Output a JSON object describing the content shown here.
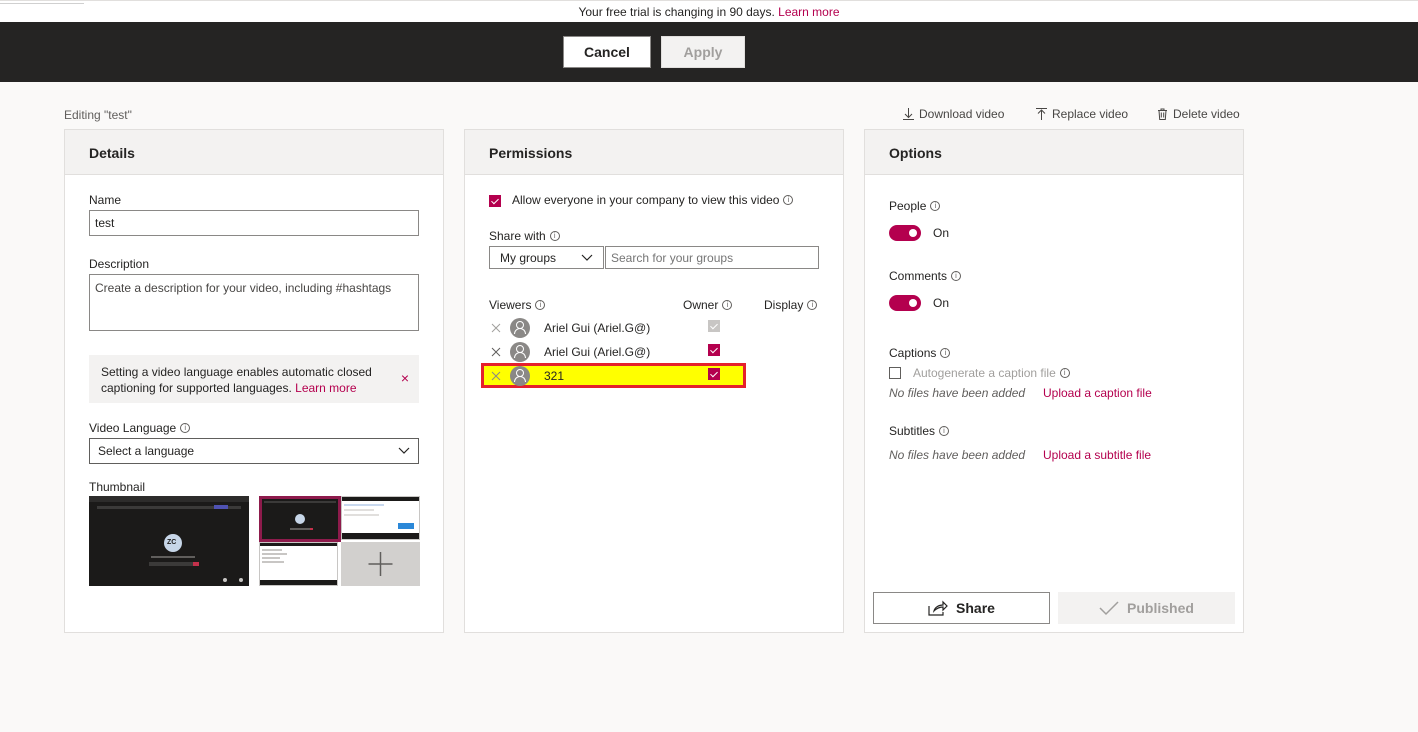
{
  "trial_banner": {
    "text": "Your free trial is changing in 90 days.",
    "link": "Learn more"
  },
  "actions": {
    "cancel": "Cancel",
    "apply": "Apply"
  },
  "editing_label": "Editing \"test\"",
  "video_actions": {
    "download": "Download video",
    "replace": "Replace video",
    "delete": "Delete video"
  },
  "details": {
    "title": "Details",
    "name_label": "Name",
    "name_value": "test",
    "description_label": "Description",
    "description_placeholder": "Create a description for your video, including #hashtags",
    "banner_text": "Setting a video language enables automatic closed captioning for supported languages.",
    "banner_link": "Learn more",
    "language_label": "Video Language",
    "language_value": "Select a language",
    "thumbnail_label": "Thumbnail",
    "thumb_initials": "ZC"
  },
  "permissions": {
    "title": "Permissions",
    "allow_everyone": "Allow everyone in your company to view this video",
    "share_with_label": "Share with",
    "share_with_value": "My groups",
    "search_placeholder": "Search for your groups",
    "col_viewers": "Viewers",
    "col_owner": "Owner",
    "col_display": "Display",
    "viewers": [
      {
        "name": "Ariel Gui (Ariel.G@)",
        "owner": "disabled"
      },
      {
        "name": "Ariel Gui (Ariel.G@)",
        "owner": "checked"
      },
      {
        "name": "321",
        "owner": "checked",
        "highlighted": true
      }
    ]
  },
  "options": {
    "title": "Options",
    "people_label": "People",
    "people_state": "On",
    "comments_label": "Comments",
    "comments_state": "On",
    "captions_label": "Captions",
    "autogenerate": "Autogenerate a caption file",
    "no_files_captions": "No files have been added",
    "upload_caption": "Upload a caption file",
    "subtitles_label": "Subtitles",
    "no_files_subtitles": "No files have been added",
    "upload_subtitle": "Upload a subtitle file",
    "share": "Share",
    "published": "Published"
  },
  "colors": {
    "accent": "#b4004e",
    "highlight": "#ffff00",
    "highlight_border": "#e5202c",
    "dark_bar": "#252423"
  }
}
